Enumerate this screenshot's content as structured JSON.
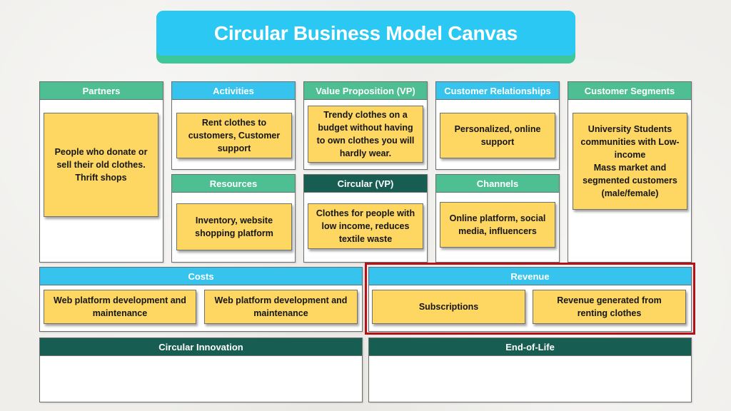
{
  "title": "Circular Business Model Canvas",
  "colors": {
    "title_blue": "#2cc8f4",
    "title_green": "#3ec79a",
    "header_green": "#4dbf93",
    "header_blue": "#36c4ef",
    "header_dark": "#185d51",
    "sticky_yellow": "#fdd762",
    "highlight_red": "#b4121a"
  },
  "sections": {
    "partners": {
      "label": "Partners",
      "notes": [
        "People who donate or\nsell their old clothes.\nThrift shops"
      ]
    },
    "activities": {
      "label": "Activities",
      "notes": [
        "Rent clothes to\ncustomers, Customer\nsupport"
      ]
    },
    "resources": {
      "label": "Resources",
      "notes": [
        "Inventory, website\nshopping platform"
      ]
    },
    "value_proposition": {
      "label": "Value Proposition (VP)",
      "notes": [
        "Trendy clothes on a\nbudget without having\nto own clothes you will\nhardly wear."
      ]
    },
    "circular_vp": {
      "label": "Circular (VP)",
      "notes": [
        "Clothes for people with\nlow income, reduces\ntextile waste"
      ]
    },
    "customer_relationships": {
      "label": "Customer Relationships",
      "notes": [
        "Personalized, online\nsupport"
      ]
    },
    "channels": {
      "label": "Channels",
      "notes": [
        "Online platform, social\nmedia, influencers"
      ]
    },
    "customer_segments": {
      "label": "Customer Segments",
      "notes": [
        "University Students\ncommunities with Low-\nincome\nMass market and\nsegmented customers\n(male/female)"
      ]
    },
    "costs": {
      "label": "Costs",
      "notes": [
        "Web platform development and\nmaintenance",
        "Web platform development and\nmaintenance"
      ]
    },
    "revenue": {
      "label": "Revenue",
      "notes": [
        "Subscriptions",
        "Revenue generated from\nrenting clothes"
      ],
      "highlighted": true
    },
    "circular_innovation": {
      "label": "Circular Innovation",
      "notes": []
    },
    "end_of_life": {
      "label": "End-of-Life",
      "notes": []
    }
  }
}
